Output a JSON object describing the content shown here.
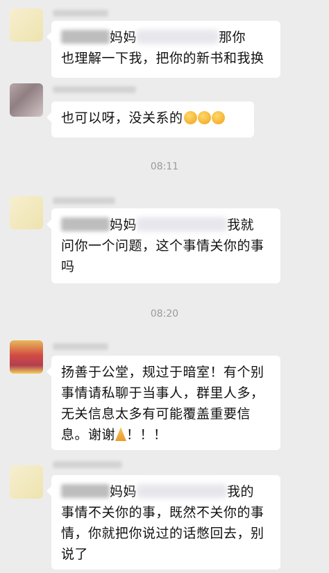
{
  "times": [
    "08:11",
    "08:20"
  ],
  "messages": [
    {
      "name_prefix": "妈妈",
      "line1_tail": "那你",
      "line2": "也理解一下我，把你的新书和我换"
    },
    {
      "text": "也可以呀，没关系的",
      "emoji": "clapping-hands"
    },
    {
      "name_prefix": "妈妈",
      "line1_tail": "我就",
      "line2": "问你一个问题，这个事情关你的事",
      "line3": "吗"
    },
    {
      "line1": "扬善于公堂，规过于暗室！有个别",
      "line2": "事情请私聊于当事人，群里人多，",
      "line3": "无关信息太多有可能覆盖重要信",
      "line4_pre": "息。谢谢",
      "line4_post": "！！！"
    },
    {
      "name_prefix": "妈妈",
      "line1_tail": "我的",
      "line2": "事情不关你的事，既然不关你的事",
      "line3": "情，你就把你说过的话憋回去，别",
      "line4": "说了"
    }
  ]
}
